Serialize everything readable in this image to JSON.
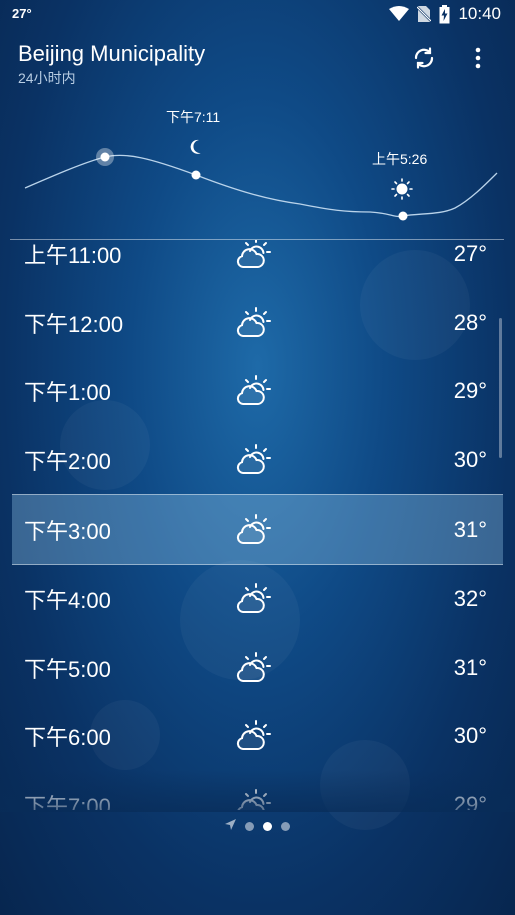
{
  "status": {
    "temp": "27°",
    "time": "10:40"
  },
  "header": {
    "title": "Beijing Municipality",
    "subtitle": "24小时内"
  },
  "graph": {
    "sunset_label": "下午7:11",
    "sunrise_label": "上午5:26"
  },
  "hourly": [
    {
      "time": "上午11:00",
      "temp": "27°",
      "icon": "partly-cloudy-icon"
    },
    {
      "time": "下午12:00",
      "temp": "28°",
      "icon": "partly-cloudy-icon"
    },
    {
      "time": "下午1:00",
      "temp": "29°",
      "icon": "partly-cloudy-icon"
    },
    {
      "time": "下午2:00",
      "temp": "30°",
      "icon": "partly-cloudy-icon"
    },
    {
      "time": "下午3:00",
      "temp": "31°",
      "icon": "partly-cloudy-icon",
      "selected": true
    },
    {
      "time": "下午4:00",
      "temp": "32°",
      "icon": "partly-cloudy-icon"
    },
    {
      "time": "下午5:00",
      "temp": "31°",
      "icon": "partly-cloudy-icon"
    },
    {
      "time": "下午6:00",
      "temp": "30°",
      "icon": "partly-cloudy-icon"
    },
    {
      "time": "下午7:00",
      "temp": "29°",
      "icon": "partly-cloudy-icon"
    }
  ],
  "pager": {
    "pages": 4,
    "active": 2
  }
}
